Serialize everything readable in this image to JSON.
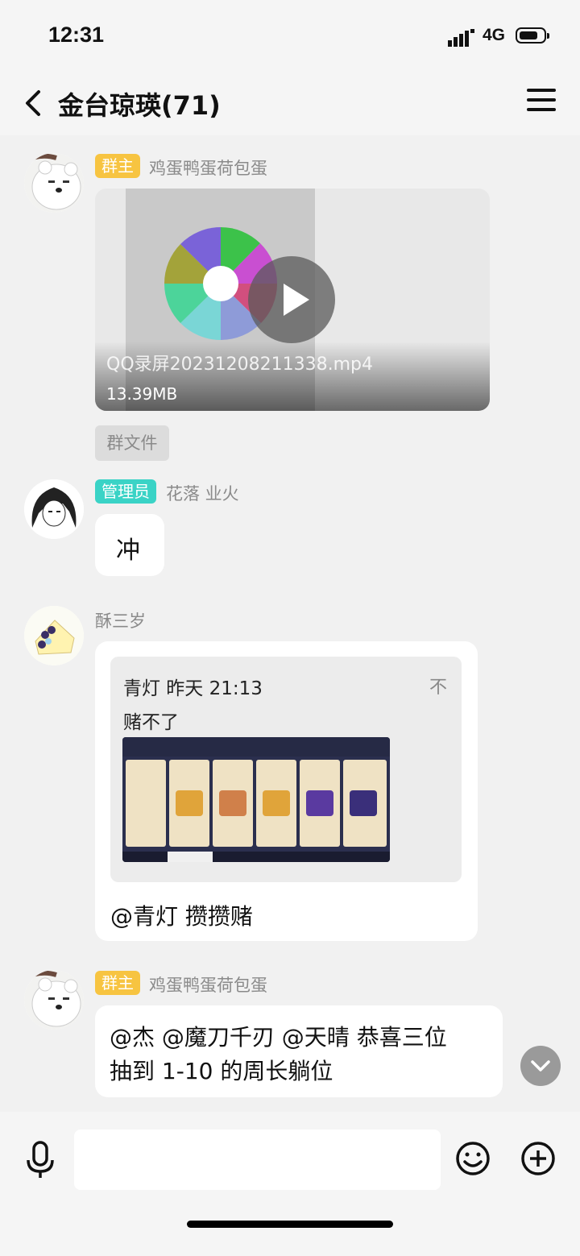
{
  "status": {
    "time": "12:31",
    "network": "4G"
  },
  "header": {
    "title": "金台琼瑛(71)"
  },
  "messages": [
    {
      "role_tag": "群主",
      "nick": "鸡蛋鸭蛋荷包蛋",
      "video": {
        "filename": "QQ录屏20231208211338.mp4",
        "size": "13.39MB"
      },
      "source_label": "群文件"
    },
    {
      "role_tag": "管理员",
      "nick": "花落 业火",
      "text": "冲"
    },
    {
      "nick": "酥三岁",
      "quote": {
        "author_time": "青灯  昨天 21:13",
        "text": "赌不了",
        "pin_icon": "不"
      },
      "text": "@青灯 攒攒赌"
    },
    {
      "role_tag": "群主",
      "nick": "鸡蛋鸭蛋荷包蛋",
      "text_line1": "@杰 @魔刀千刃 @天晴 恭喜三位",
      "text_line2": "抽到 1-10 的周长躺位"
    }
  ],
  "input": {
    "placeholder": ""
  }
}
